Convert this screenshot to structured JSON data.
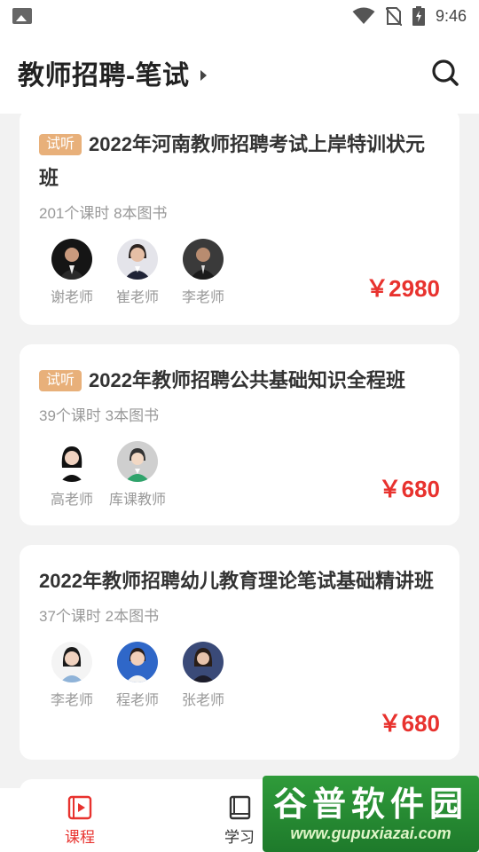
{
  "status_bar": {
    "time": "9:46"
  },
  "header": {
    "title": "教师招聘-笔试"
  },
  "courses": [
    {
      "badge": "试听",
      "title": "2022年河南教师招聘考试上岸特训状元班",
      "meta": "201个课时 8本图书",
      "teachers": [
        "谢老师",
        "崔老师",
        "李老师"
      ],
      "price": "￥2980"
    },
    {
      "badge": "试听",
      "title": "2022年教师招聘公共基础知识全程班",
      "meta": "39个课时 3本图书",
      "teachers": [
        "高老师",
        "库课教师"
      ],
      "price": "￥680"
    },
    {
      "badge": "",
      "title": "2022年教师招聘幼儿教育理论笔试基础精讲班",
      "meta": "37个课时 2本图书",
      "teachers": [
        "李老师",
        "程老师",
        "张老师"
      ],
      "price": "￥680"
    }
  ],
  "tabbar": {
    "tabs": [
      {
        "label": "课程",
        "icon": "course-video-icon",
        "active": true
      },
      {
        "label": "学习",
        "icon": "book-icon",
        "active": false
      }
    ]
  },
  "watermark": {
    "title": "谷普软件园",
    "url": "www.gupuxiazai.com"
  },
  "colors": {
    "accent": "#e8322e",
    "badge": "#e8b07a"
  }
}
